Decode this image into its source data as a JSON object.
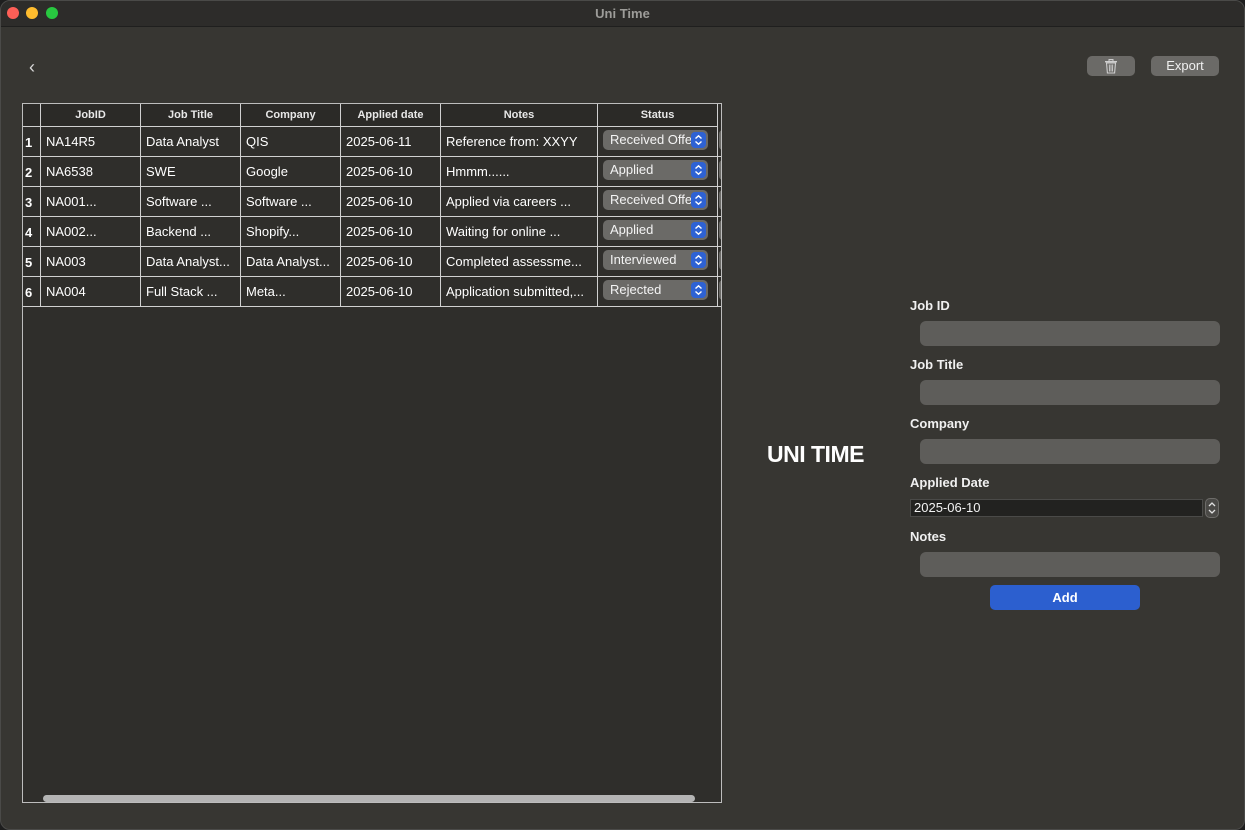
{
  "window": {
    "title": "Uni Time"
  },
  "toolbar": {
    "back_glyph": "‹",
    "export_label": "Export",
    "trash_icon": "trash-icon"
  },
  "table": {
    "columns": [
      "JobID",
      "Job Title",
      "Company",
      "Applied date",
      "Notes",
      "Status"
    ],
    "rows": [
      {
        "num": "1",
        "job_id": "NA14R5",
        "title": "Data Analyst",
        "company": "QIS",
        "date": "2025-06-11",
        "notes": "Reference from: XXYY",
        "status": "Received Offer"
      },
      {
        "num": "2",
        "job_id": "NA6538",
        "title": "SWE",
        "company": "Google",
        "date": "2025-06-10",
        "notes": "Hmmm......",
        "status": "Applied"
      },
      {
        "num": "3",
        "job_id": "NA001...",
        "title": "Software ...",
        "company": "Software ...",
        "date": "2025-06-10",
        "notes": "Applied via careers ...",
        "status": "Received Offer"
      },
      {
        "num": "4",
        "job_id": "NA002...",
        "title": "Backend ...",
        "company": "Shopify...",
        "date": "2025-06-10",
        "notes": "Waiting for online ...",
        "status": "Applied"
      },
      {
        "num": "5",
        "job_id": "NA003",
        "title": "Data Analyst...",
        "company": "Data Analyst...",
        "date": "2025-06-10",
        "notes": "Completed assessme...",
        "status": "Interviewed"
      },
      {
        "num": "6",
        "job_id": "NA004",
        "title": "Full Stack ...",
        "company": "Meta...",
        "date": "2025-06-10",
        "notes": "Application submitted,...",
        "status": "Rejected"
      }
    ]
  },
  "brand": {
    "text": "UNI TIME"
  },
  "form": {
    "job_id_label": "Job ID",
    "job_id_value": "",
    "job_title_label": "Job Title",
    "job_title_value": "",
    "company_label": "Company",
    "company_value": "",
    "applied_date_label": "Applied Date",
    "applied_date_value": "2025-06-10",
    "notes_label": "Notes",
    "notes_value": "",
    "add_label": "Add"
  },
  "colors": {
    "accent": "#2c5fcf",
    "window_bg": "#373632",
    "field_bg": "#5e5d5a"
  }
}
